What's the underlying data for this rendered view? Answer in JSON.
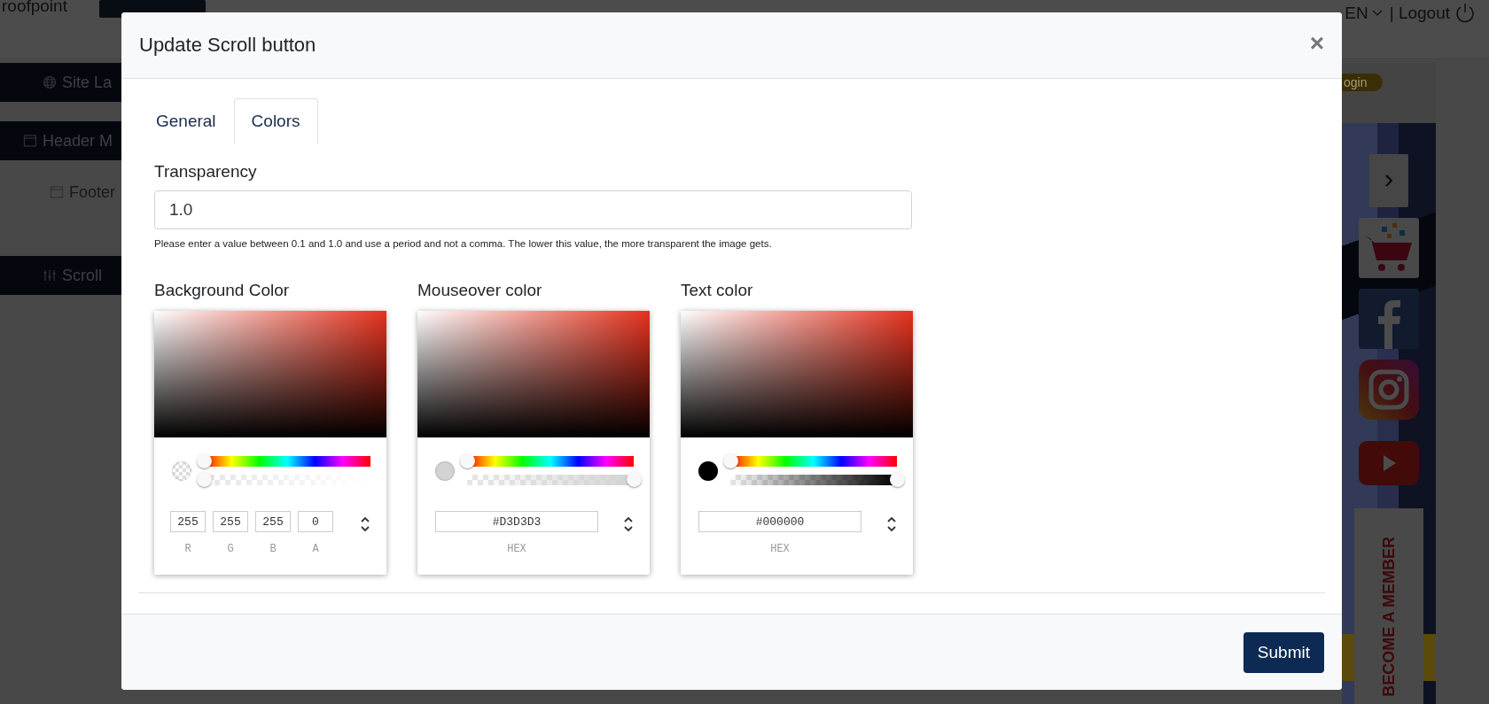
{
  "topbar": {
    "logo": "roofpoint",
    "language": "EN",
    "logout": "| Logout"
  },
  "sidebar": {
    "items": [
      {
        "label": "Site La"
      },
      {
        "label": "Header M",
        "children": [
          {
            "label": "Footer"
          }
        ]
      },
      {
        "label": "Scroll"
      }
    ]
  },
  "preview": {
    "login": "ogin",
    "member_tab": "BECOME A MEMBER"
  },
  "modal": {
    "title": "Update Scroll button",
    "close": "×",
    "tabs": [
      {
        "label": "General",
        "selected": false
      },
      {
        "label": "Colors",
        "selected": true
      }
    ],
    "transparency": {
      "label": "Transparency",
      "value": "1.0",
      "help": "Please enter a value between 0.1 and 1.0 and use a period and not a comma. The lower this value, the more transparent the image gets."
    },
    "pickers": [
      {
        "label": "Background Color",
        "kind": "rgba",
        "color": "#ffffff",
        "sliders": [
          {
            "kind": "hue",
            "level": 0
          },
          {
            "kind": "alpha",
            "level": 0
          }
        ],
        "fields": [
          {
            "value": "255",
            "label": "R"
          },
          {
            "value": "255",
            "label": "G"
          },
          {
            "value": "255",
            "label": "B"
          },
          {
            "value": "0",
            "label": "A"
          }
        ]
      },
      {
        "label": "Mouseover color",
        "kind": "hex",
        "color": "#d3d3d3",
        "sliders": [
          {
            "kind": "hue",
            "level": 0
          },
          {
            "kind": "alpha",
            "level": 1
          }
        ],
        "fields": [
          {
            "value": "#D3D3D3",
            "label": "HEX"
          }
        ]
      },
      {
        "label": "Text color",
        "kind": "hex",
        "color": "#000000",
        "sliders": [
          {
            "kind": "hue",
            "level": 0
          },
          {
            "kind": "alpha",
            "level": 1
          }
        ],
        "fields": [
          {
            "value": "#000000",
            "label": "HEX"
          }
        ]
      }
    ],
    "submit": "Submit"
  }
}
